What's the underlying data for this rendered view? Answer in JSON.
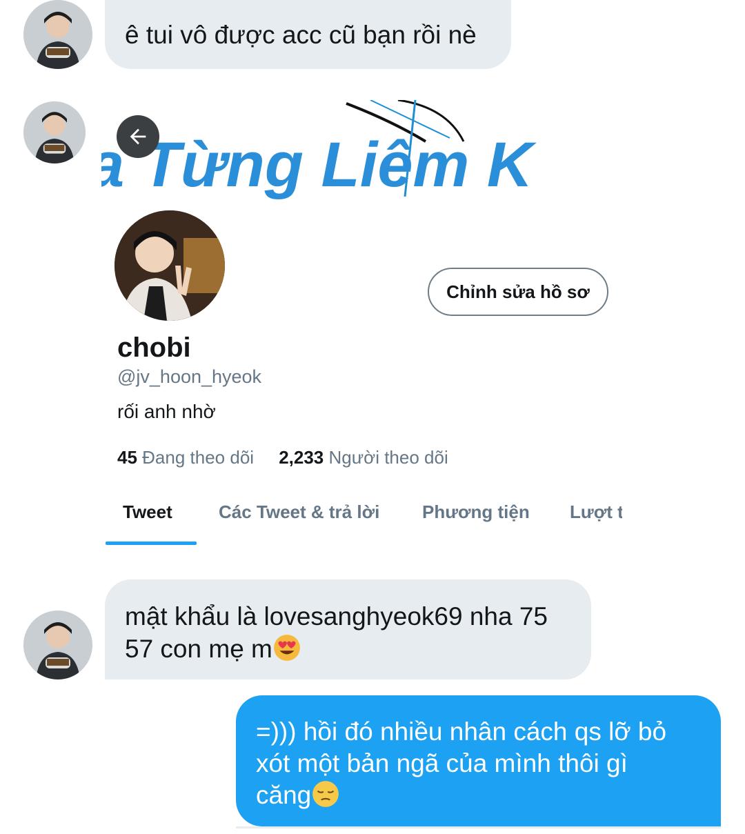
{
  "messages": [
    {
      "text": "ê tui vô được acc cũ bạn rồi nè"
    },
    {
      "text_line1": "mật khẩu là lovesanghyeok69 nha 75",
      "text_line2": "57 con mẹ m",
      "emoji": "heart-eyes-emoji"
    },
    {
      "line1": "=))) hồi đó nhiều nhân cách qs lỡ bỏ",
      "line2": "xót một bản ngã của mình thôi gì",
      "line3": "căng",
      "emoji": "pensive-emoji"
    }
  ],
  "profile": {
    "banner_text": "a Từng Liêm K",
    "name": "chobi",
    "handle": "@jv_hoon_hyeok",
    "bio": "rối anh nhờ",
    "following_count": "45",
    "following_label": "Đang theo dõi",
    "followers_count": "2,233",
    "followers_label": "Người theo dõi",
    "edit_button": "Chỉnh sửa hồ sơ",
    "tabs": [
      "Tweet",
      "Các Tweet & trả lời",
      "Phương tiện",
      "Lượt thích"
    ]
  },
  "colors": {
    "incoming_bubble": "#e6ecf0",
    "outgoing_bubble": "#1da1f2",
    "accent": "#1da1f2"
  },
  "icons": [
    "back-arrow-icon",
    "avatar",
    "heart-eyes-emoji",
    "pensive-emoji"
  ]
}
